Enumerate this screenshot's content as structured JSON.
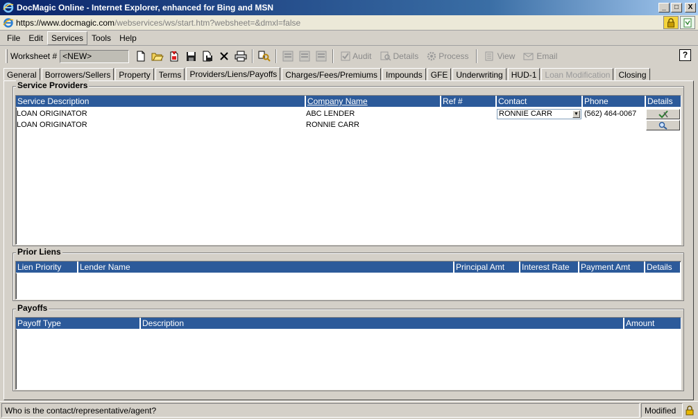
{
  "window": {
    "title": "DocMagic Online - Internet Explorer, enhanced for Bing and MSN",
    "controls": [
      "_",
      "□",
      "X"
    ]
  },
  "address": {
    "scheme": "https://www.",
    "host": "docmagic.com",
    "path": "/webservices/ws/start.htm?websheet=&dmxl=false"
  },
  "menu": [
    "File",
    "Edit",
    "Services",
    "Tools",
    "Help"
  ],
  "toolbar": {
    "worksheet_label": "Worksheet #",
    "worksheet_value": "<NEW>",
    "audit": "Audit",
    "details": "Details",
    "process": "Process",
    "view": "View",
    "email": "Email",
    "help": "?"
  },
  "tabs": [
    {
      "label": "General"
    },
    {
      "label": "Borrowers/Sellers"
    },
    {
      "label": "Property"
    },
    {
      "label": "Terms"
    },
    {
      "label": "Providers/Liens/Payoffs"
    },
    {
      "label": "Charges/Fees/Premiums"
    },
    {
      "label": "Impounds"
    },
    {
      "label": "GFE"
    },
    {
      "label": "Underwriting"
    },
    {
      "label": "HUD-1"
    },
    {
      "label": "Loan Modification"
    },
    {
      "label": "Closing"
    }
  ],
  "service_providers": {
    "title": "Service Providers",
    "columns": [
      "Service Description",
      "Company Name",
      "Ref #",
      "Contact",
      "Phone",
      "Details"
    ],
    "rows": [
      {
        "description": "LOAN ORIGINATOR",
        "company": "ABC LENDER",
        "ref": "",
        "contact": "RONNIE CARR",
        "phone": "(562) 464-0067"
      },
      {
        "description": "LOAN ORIGINATOR",
        "company": "RONNIE CARR",
        "ref": "",
        "contact": "",
        "phone": ""
      }
    ]
  },
  "prior_liens": {
    "title": "Prior Liens",
    "columns": [
      "Lien Priority",
      "Lender Name",
      "Principal Amt",
      "Interest Rate",
      "Payment Amt",
      "Details"
    ]
  },
  "payoffs": {
    "title": "Payoffs",
    "columns": [
      "Payoff Type",
      "Description",
      "Amount"
    ]
  },
  "status": {
    "message": "Who is the contact/representative/agent?",
    "state": "Modified"
  },
  "colors": {
    "header_blue": "#2c5a9a",
    "title_blue": "#0a246a",
    "face": "#d4d0c8"
  }
}
